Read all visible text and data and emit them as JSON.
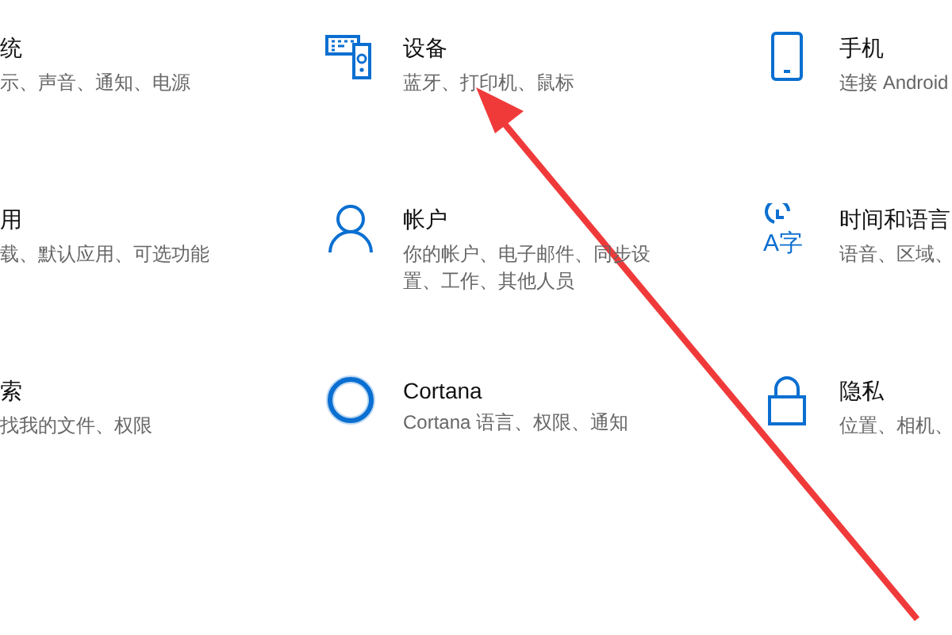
{
  "settings": [
    {
      "kind": "none",
      "title": "统",
      "subtitle": "示、声音、通知、电源"
    },
    {
      "kind": "devices",
      "title": "设备",
      "subtitle": "蓝牙、打印机、鼠标"
    },
    {
      "kind": "phone",
      "title": "手机",
      "subtitle": "连接 Android"
    },
    {
      "kind": "none",
      "title": "用",
      "subtitle": "载、默认应用、可选功能"
    },
    {
      "kind": "accounts",
      "title": "帐户",
      "subtitle": "你的帐户、电子邮件、同步设置、工作、其他人员"
    },
    {
      "kind": "time",
      "icon_text": "A字",
      "title": "时间和语言",
      "subtitle": "语音、区域、"
    },
    {
      "kind": "none",
      "title": "索",
      "subtitle": "找我的文件、权限"
    },
    {
      "kind": "cortana",
      "title": "Cortana",
      "subtitle": "Cortana 语言、权限、通知"
    },
    {
      "kind": "privacy",
      "title": "隐私",
      "subtitle": "位置、相机、"
    }
  ]
}
